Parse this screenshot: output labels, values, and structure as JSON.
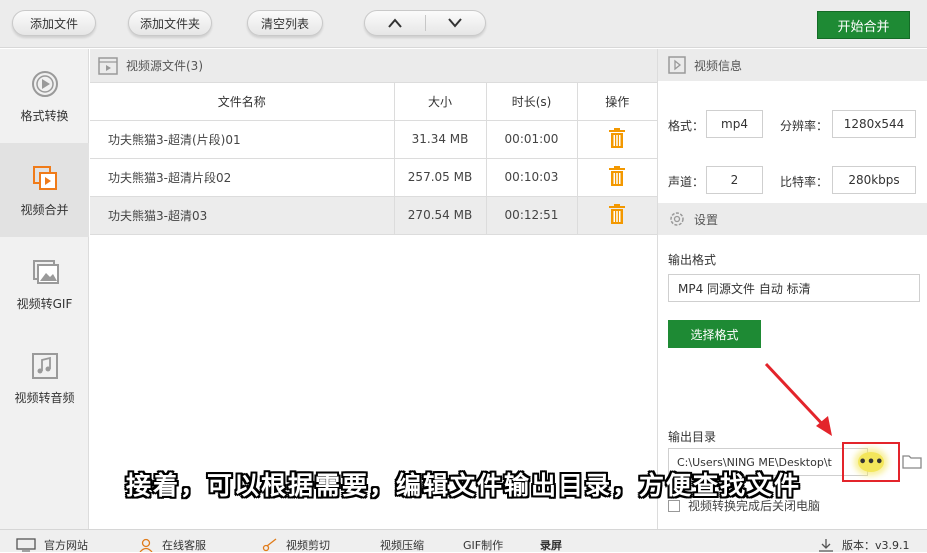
{
  "toolbar": {
    "add_file": "添加文件",
    "add_folder": "添加文件夹",
    "clear_list": "清空列表",
    "start_merge": "开始合并"
  },
  "sidebar": {
    "items": [
      {
        "label": "格式转换",
        "icon": "play-circle-icon"
      },
      {
        "label": "视频合并",
        "icon": "merge-video-icon"
      },
      {
        "label": "视频转GIF",
        "icon": "image-icon"
      },
      {
        "label": "视频转音频",
        "icon": "music-icon"
      }
    ]
  },
  "files": {
    "header": "视频源文件(3)",
    "columns": [
      "文件名称",
      "大小",
      "时长(s)",
      "操作"
    ],
    "rows": [
      {
        "name": "功夫熊猫3-超清(片段)01",
        "size": "31.34 MB",
        "duration": "00:01:00"
      },
      {
        "name": "功夫熊猫3-超清片段02",
        "size": "257.05 MB",
        "duration": "00:10:03"
      },
      {
        "name": "功夫熊猫3-超清03",
        "size": "270.54 MB",
        "duration": "00:12:51"
      }
    ]
  },
  "info": {
    "header": "视频信息",
    "format_label": "格式：",
    "format_value": "mp4",
    "resolution_label": "分辨率：",
    "resolution_value": "1280x544",
    "channels_label": "声道：",
    "channels_value": "2",
    "bitrate_label": "比特率：",
    "bitrate_value": "280kbps"
  },
  "settings": {
    "header": "设置",
    "output_format_label": "输出格式",
    "output_format_value": "MP4 同源文件 自动 标清",
    "choose_format": "选择格式",
    "output_dir_label": "输出目录",
    "output_dir_value": "C:\\Users\\NING ME\\Desktop\\t",
    "more_button": "•••",
    "close_after": "视频转换完成后关闭电脑"
  },
  "statusbar": {
    "website": "官方网站",
    "support": "在线客服",
    "video_edit": "视频剪切",
    "video_compress": "视频压缩",
    "gif_make": "GIF制作",
    "record": "录屏",
    "version": "版本：v3.9.1"
  },
  "subtitle": "接着，可以根据需要，编辑文件输出目录，方便查找文件",
  "colors": {
    "accent_green": "#1e8a34",
    "trash_orange": "#f39800",
    "highlight_red": "#e3242b"
  }
}
